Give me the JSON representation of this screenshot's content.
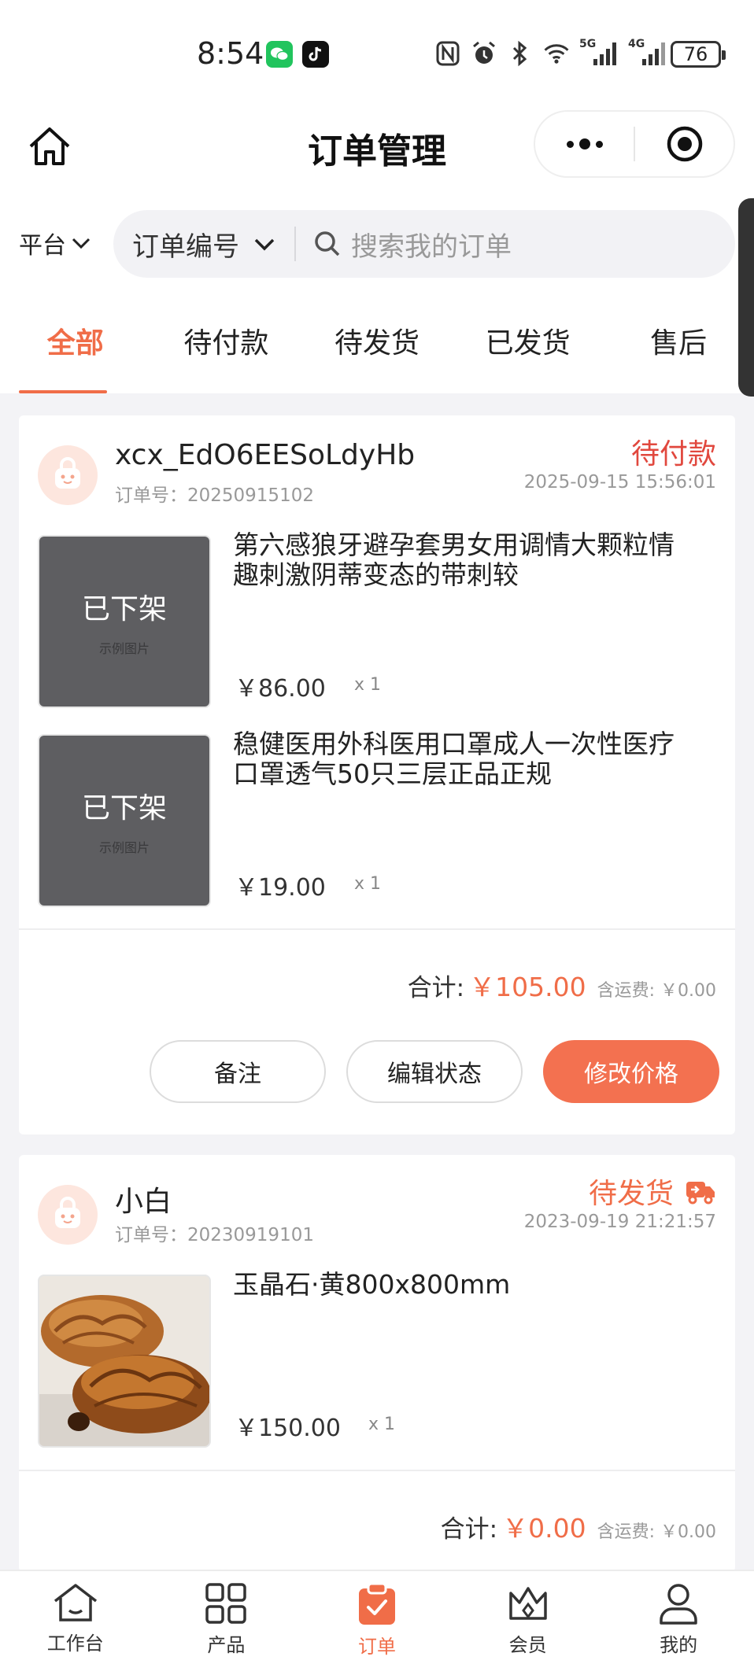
{
  "status_bar": {
    "time": "8:54",
    "battery": "76",
    "network_1": "5G",
    "network_2": "4G"
  },
  "nav": {
    "title": "订单管理"
  },
  "search": {
    "platform_label": "平台",
    "field_label": "订单编号",
    "placeholder": "搜索我的订单"
  },
  "tabs": [
    {
      "label": "全部",
      "active": true
    },
    {
      "label": "待付款",
      "active": false
    },
    {
      "label": "待发货",
      "active": false
    },
    {
      "label": "已发货",
      "active": false
    },
    {
      "label": "售后",
      "active": false
    }
  ],
  "orders": [
    {
      "user": "xcx_EdO6EESoLdyHb",
      "order_no": "订单号：20250915102",
      "status": "待付款",
      "time": "2025-09-15 15:56:01",
      "items": [
        {
          "title": "第六感狼牙避孕套男女用调情大颗粒情趣刺激阴蒂变态的带刺较",
          "price": "￥86.00",
          "qty": "x 1",
          "overlay": "已下架",
          "overlay_sub": "示例图片"
        },
        {
          "title": "稳健医用外科医用口罩成人一次性医疗口罩透气50只三层正品正规",
          "price": "￥19.00",
          "qty": "x 1",
          "overlay": "已下架",
          "overlay_sub": "示例图片"
        }
      ],
      "total_label": "合计:",
      "total_amount": "￥105.00",
      "shipping": "含运费: ￥0.00",
      "buttons": [
        "备注",
        "编辑状态",
        "修改价格"
      ]
    },
    {
      "user": "小白",
      "order_no": "订单号：20230919101",
      "status": "待发货",
      "time": "2023-09-19 21:21:57",
      "items": [
        {
          "title": "玉晶石·黄800x800mm",
          "price": "￥150.00",
          "qty": "x 1"
        }
      ],
      "total_label": "合计:",
      "total_amount": "￥0.00",
      "shipping": "含运费: ￥0.00"
    }
  ],
  "tab_bar": [
    {
      "label": "工作台",
      "icon": "home-icon"
    },
    {
      "label": "产品",
      "icon": "grid-icon"
    },
    {
      "label": "订单",
      "icon": "clipboard-icon",
      "active": true
    },
    {
      "label": "会员",
      "icon": "crown-icon"
    },
    {
      "label": "我的",
      "icon": "user-icon"
    }
  ],
  "colors": {
    "accent": "#f06d48",
    "status_pending_pay": "#e1483e",
    "primary_button": "#f37150"
  }
}
